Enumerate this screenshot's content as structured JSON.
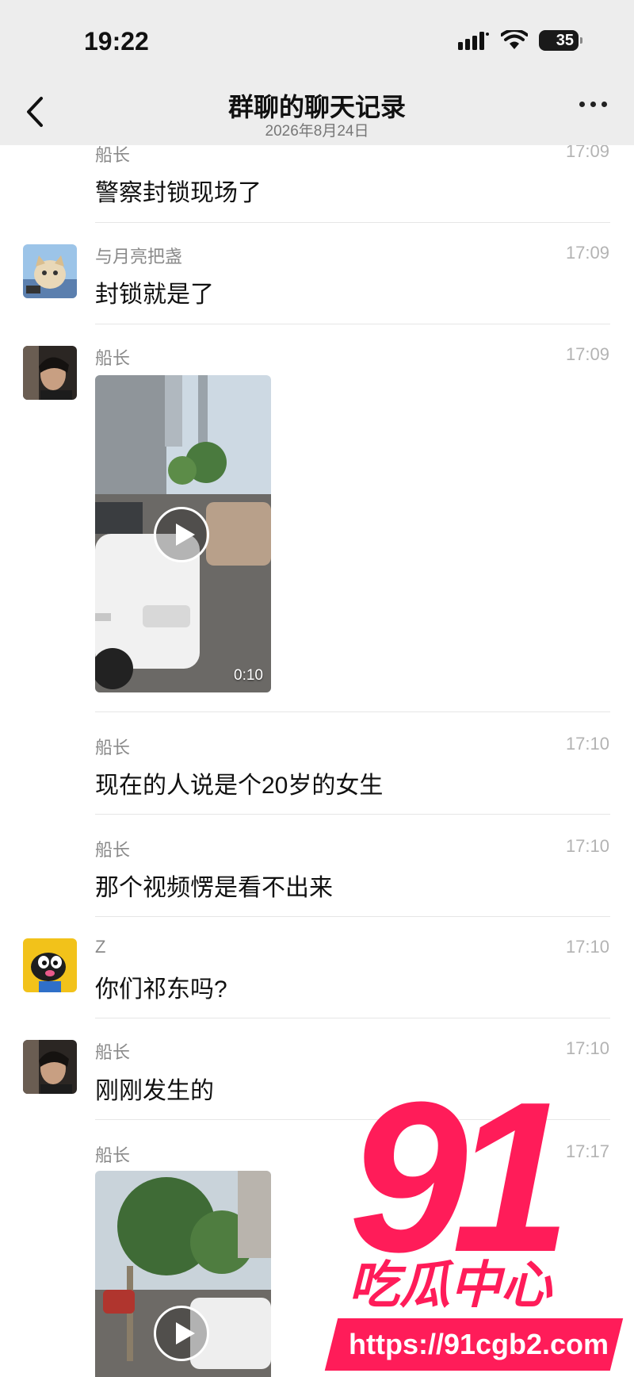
{
  "status_bar": {
    "time": "19:22",
    "battery": "35"
  },
  "header": {
    "title": "群聊的聊天记录",
    "subtitle": "2026年8月24日"
  },
  "messages": [
    {
      "sender": "船长",
      "time": "17:09",
      "text": "警察封锁现场了"
    },
    {
      "sender": "与月亮把盏",
      "time": "17:09",
      "text": "封锁就是了"
    },
    {
      "sender": "船长",
      "time": "17:09",
      "video_duration": "0:10"
    },
    {
      "sender": "船长",
      "time": "17:10",
      "text": "现在的人说是个20岁的女生"
    },
    {
      "sender": "船长",
      "time": "17:10",
      "text": "那个视频愣是看不出来"
    },
    {
      "sender": "Z",
      "time": "17:10",
      "text": "你们祁东吗?"
    },
    {
      "sender": "船长",
      "time": "17:10",
      "text": "刚刚发生的"
    },
    {
      "sender": "船长",
      "time": "17:17"
    }
  ],
  "watermark": {
    "number": "91",
    "name": "吃瓜中心",
    "url": "https://91cgb2.com"
  },
  "colors": {
    "watermark": "#ff1c59",
    "header_bg": "#ededed"
  }
}
